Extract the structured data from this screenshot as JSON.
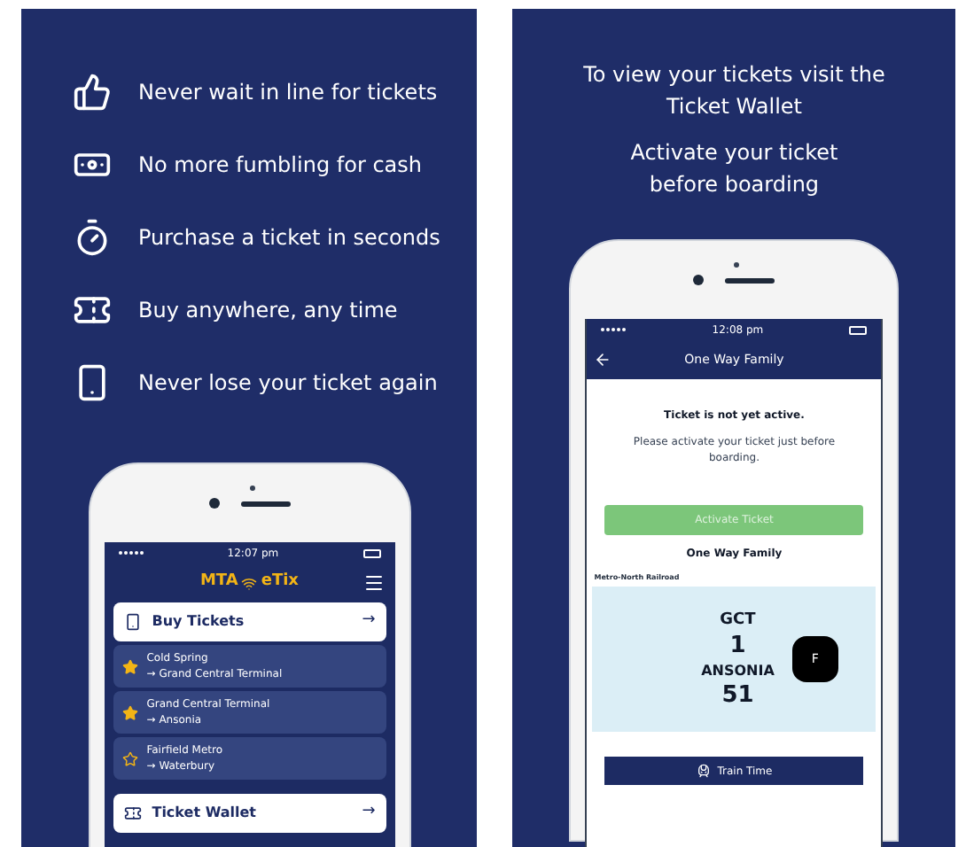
{
  "left_panel": {
    "features": [
      {
        "text": "Never wait in line for tickets"
      },
      {
        "text": "No more fumbling for cash"
      },
      {
        "text": "Purchase a ticket in seconds"
      },
      {
        "text": "Buy anywhere, any time"
      },
      {
        "text": "Never lose your ticket again"
      }
    ],
    "phone": {
      "status_time": "12:07 pm",
      "logo": {
        "left": "MTA",
        "right": "eTix"
      },
      "buy_tickets": {
        "label": "Buy Tickets",
        "arrow": "→"
      },
      "favorites": [
        {
          "from": "Cold Spring",
          "to": "Grand Central Terminal",
          "arrow": "→",
          "favorite": true
        },
        {
          "from": "Grand Central Terminal",
          "to": "Ansonia",
          "arrow": "→",
          "favorite": true
        },
        {
          "from": "Fairfield Metro",
          "to": "Waterbury",
          "arrow": "→",
          "favorite": false
        }
      ],
      "ticket_wallet": {
        "label": "Ticket Wallet",
        "arrow": "→"
      }
    }
  },
  "right_panel": {
    "headline_1": "To view your tickets visit the Ticket Wallet",
    "headline_2": "Activate your ticket before boarding",
    "phone": {
      "status_time": "12:08 pm",
      "title": "One Way Family",
      "notice_title": "Ticket is not yet active.",
      "notice_text": "Please activate your ticket just before boarding.",
      "activate_button": {
        "label": "Activate Ticket",
        "disabled": true
      },
      "ticket_type": "One Way Family",
      "railroad": "Metro-North Railroad",
      "ticket": {
        "origin": "GCT",
        "origin_zone": "1",
        "destination": "ANSONIA",
        "destination_zone": "51",
        "badge": "F"
      },
      "train_time_button": "Train Time"
    }
  }
}
